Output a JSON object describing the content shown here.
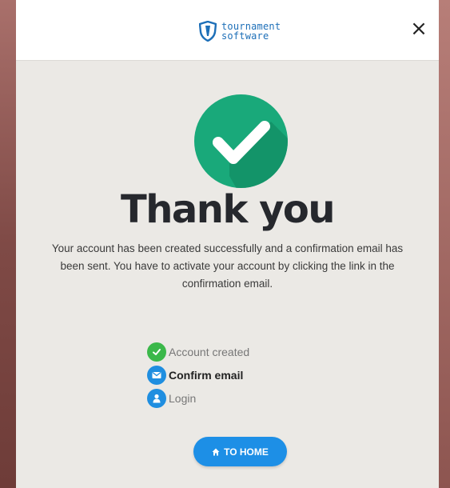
{
  "brand": {
    "line1": "tournament",
    "line2": "software",
    "color": "#1d6fb8"
  },
  "header": {
    "close_glyph": "×",
    "close_icon": "close-icon"
  },
  "hero": {
    "icon": "check-icon",
    "circle_color": "#19a97a",
    "title": "Thank you",
    "message": "Your account has been created successfully and a confirmation email has been sent. You have to activate your account by clicking the link in the confirmation email."
  },
  "steps": [
    {
      "label": "Account created",
      "state": "done",
      "icon": "check-icon",
      "color": "#3bb84a"
    },
    {
      "label": "Confirm email",
      "state": "current",
      "icon": "envelope-icon",
      "color": "#1f8ee0"
    },
    {
      "label": "Login",
      "state": "pending",
      "icon": "user-icon",
      "color": "#1f8ee0"
    }
  ],
  "action": {
    "home_label": "TO HOME",
    "icon": "home-icon",
    "color": "#1d8fe6"
  }
}
